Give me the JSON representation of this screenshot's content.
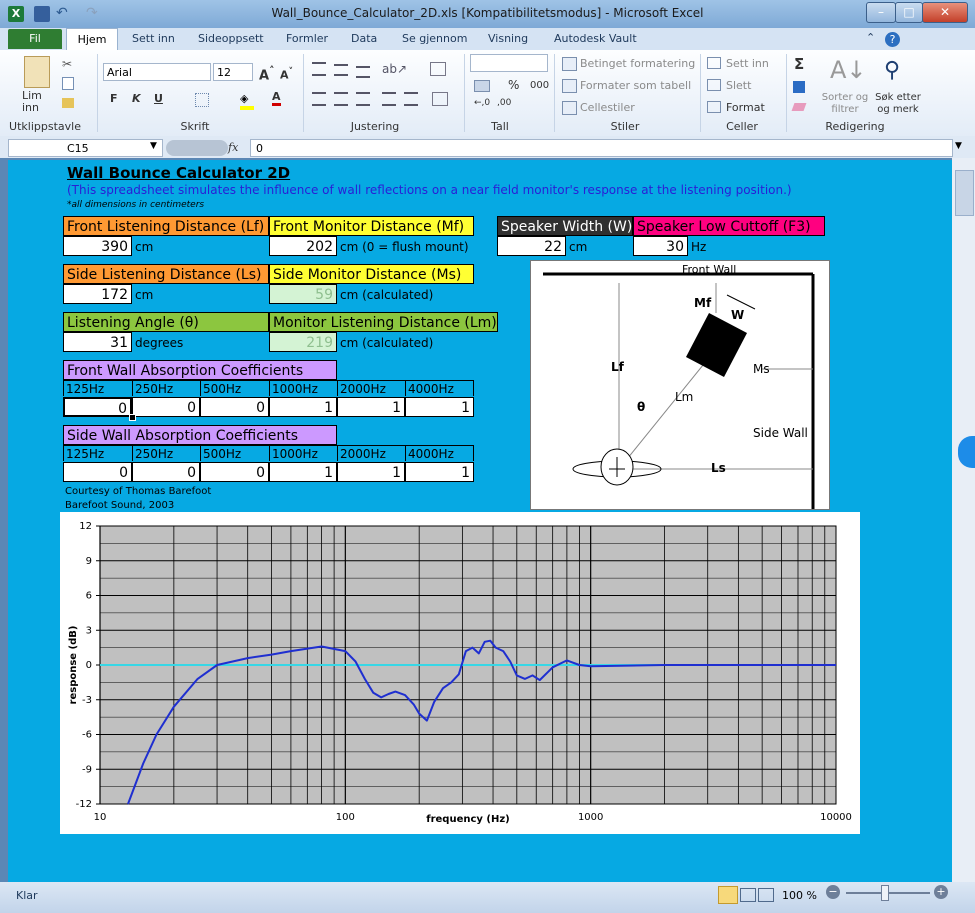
{
  "window": {
    "title": "Wall_Bounce_Calculator_2D.xls  [Kompatibilitetsmodus]  -  Microsoft Excel",
    "minimize": "–",
    "maximize": "□",
    "close": "✕"
  },
  "ribbon_tabs": [
    "Fil",
    "Hjem",
    "Sett inn",
    "Sideoppsett",
    "Formler",
    "Data",
    "Se gjennom",
    "Visning",
    "Autodesk Vault"
  ],
  "ribbon": {
    "groups": [
      "Utklippstavle",
      "Skrift",
      "Justering",
      "Tall",
      "Stiler",
      "Celler",
      "Redigering"
    ],
    "paste": "Lim\ninn",
    "font_name": "Arial",
    "font_size": "12",
    "bold": "F",
    "italic": "K",
    "underline": "U",
    "percent": "%",
    "thousands": "000",
    "conditional": "Betinget formatering",
    "format_table": "Formater som tabell",
    "cell_styles": "Cellestiler",
    "insert": "Sett inn",
    "delete": "Slett",
    "format": "Format",
    "sum": "Σ",
    "sort_filter": "Sorter og filtrer",
    "find_select": "Søk etter og merk"
  },
  "formula_bar": {
    "name_box": "C15",
    "fx": "fx",
    "value": "0"
  },
  "sheet": {
    "title": "Wall Bounce Calculator 2D",
    "subtitle": "(This spreadsheet simulates the influence of wall reflections on a near field monitor's response at the listening position.)",
    "note": "*all dimensions in centimeters",
    "front_listening": {
      "label": "Front Listening Distance (Lf)",
      "value": "390",
      "unit": "cm"
    },
    "front_monitor": {
      "label": "Front Monitor Distance (Mf)",
      "value": "202",
      "unit": "cm  (0 = flush mount)"
    },
    "speaker_width": {
      "label": "Speaker Width (W)",
      "value": "22",
      "unit": "cm"
    },
    "speaker_cutoff": {
      "label": "Speaker Low Cuttoff (F3)",
      "value": "30",
      "unit": "Hz"
    },
    "side_listening": {
      "label": "Side Listening Distance (Ls)",
      "value": "172",
      "unit": "cm"
    },
    "side_monitor": {
      "label": "Side Monitor Distance (Ms)",
      "value": "59",
      "unit": "cm  (calculated)"
    },
    "listening_angle": {
      "label": "Listening Angle (θ)",
      "value": "31",
      "unit": "degrees"
    },
    "monitor_listening": {
      "label": "Monitor Listening Distance (Lm)",
      "value": "219",
      "unit": "cm  (calculated)"
    },
    "front_absorption": {
      "label": "Front Wall Absorption Coefficients",
      "bands": [
        "125Hz",
        "250Hz",
        "500Hz",
        "1000Hz",
        "2000Hz",
        "4000Hz"
      ],
      "values": [
        "0",
        "0",
        "0",
        "1",
        "1",
        "1"
      ]
    },
    "side_absorption": {
      "label": "Side Wall Absorption Coefficients",
      "bands": [
        "125Hz",
        "250Hz",
        "500Hz",
        "1000Hz",
        "2000Hz",
        "4000Hz"
      ],
      "values": [
        "0",
        "0",
        "0",
        "1",
        "1",
        "1"
      ]
    },
    "credit1": "Courtesy of Thomas Barefoot",
    "credit2": "Barefoot Sound, 2003"
  },
  "diagram": {
    "front_wall": "Front Wall",
    "side_wall": "Side Wall",
    "mf": "Mf",
    "w": "W",
    "lf": "Lf",
    "ms": "Ms",
    "lm": "Lm",
    "theta": "θ",
    "ls": "Ls"
  },
  "chart_data": {
    "type": "line",
    "xlabel": "frequency (Hz)",
    "ylabel": "response (dB)",
    "x_scale": "log",
    "xlim": [
      10,
      10000
    ],
    "ylim": [
      -12,
      12
    ],
    "x_ticks": [
      "10",
      "100",
      "1000",
      "10000"
    ],
    "y_ticks": [
      "12",
      "9",
      "6",
      "3",
      "0",
      "-3",
      "-6",
      "-9",
      "-12"
    ],
    "grid": true,
    "series": [
      {
        "color": "#1f2fd0",
        "x": [
          13,
          15,
          17,
          20,
          25,
          30,
          40,
          50,
          60,
          80,
          100,
          110,
          120,
          130,
          140,
          150,
          160,
          175,
          190,
          200,
          215,
          230,
          250,
          270,
          290,
          310,
          330,
          350,
          370,
          390,
          410,
          440,
          470,
          500,
          540,
          580,
          620,
          700,
          800,
          900,
          1000,
          2000,
          5000,
          10000
        ],
        "values": [
          -12.0,
          -8.5,
          -6.0,
          -3.6,
          -1.2,
          0.0,
          0.6,
          0.9,
          1.2,
          1.6,
          1.2,
          0.3,
          -1.2,
          -2.4,
          -2.8,
          -2.5,
          -2.3,
          -2.6,
          -3.4,
          -4.2,
          -4.8,
          -3.2,
          -2.0,
          -1.5,
          -0.8,
          1.2,
          1.5,
          1.0,
          2.0,
          2.1,
          1.5,
          1.2,
          0.3,
          -0.9,
          -1.2,
          -0.9,
          -1.3,
          -0.2,
          0.4,
          0.0,
          -0.1,
          0.0,
          0.0,
          0.0
        ]
      },
      {
        "color": "#37d7e6",
        "x": [
          10,
          10000
        ],
        "values": [
          0,
          0
        ]
      }
    ]
  },
  "status": {
    "ready": "Klar",
    "zoom": "100 %"
  }
}
